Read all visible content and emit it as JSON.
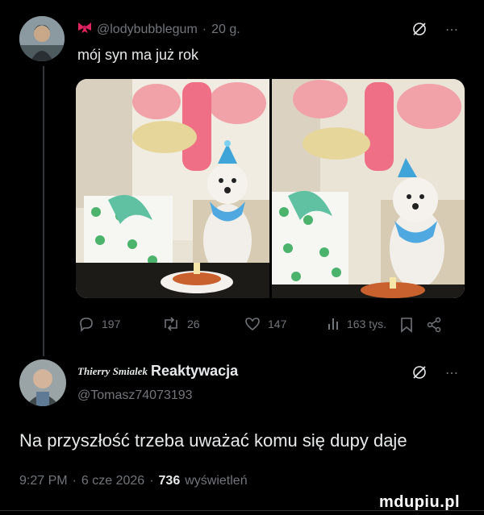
{
  "post1": {
    "handle": "@lodybubblegum",
    "time": "20 g.",
    "text": "mój syn ma już rok",
    "stats": {
      "replies": "197",
      "reposts": "26",
      "likes": "147",
      "views": "163 tys."
    }
  },
  "post2": {
    "display_name": "Thierry Smialek",
    "title": "Reaktywacja",
    "handle": "@Tomasz74073193",
    "text": "Na przyszłość trzeba uważać komu się dupy daje",
    "time": "9:27 PM",
    "date": "6 cze 2026",
    "views_count": "736",
    "views_label": "wyświetleń"
  },
  "watermark": "mdupiu.pl",
  "colors": {
    "background": "#000000",
    "text": "#e7e9ea",
    "muted": "#71767b",
    "divider": "#2f3336"
  },
  "icons": [
    "bow-icon",
    "grok-icon",
    "more-icon",
    "reply-icon",
    "repost-icon",
    "like-icon",
    "views-icon",
    "bookmark-icon",
    "share-icon"
  ]
}
